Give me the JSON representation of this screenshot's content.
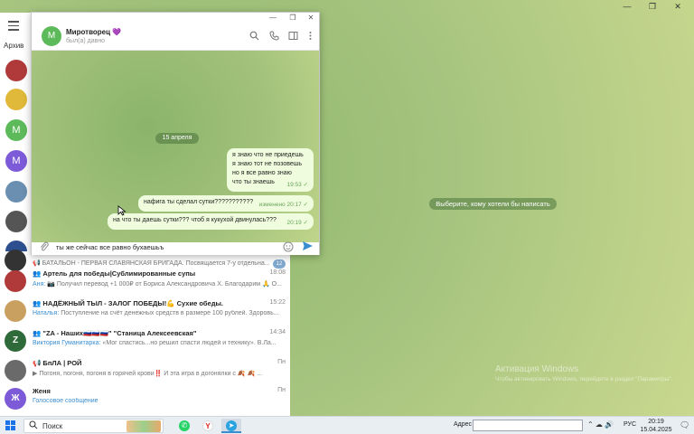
{
  "window": {
    "minimize": "—",
    "maximize": "❐",
    "close": "✕"
  },
  "sidebar": {
    "archive_label": "Архив",
    "avatars": [
      {
        "letter": "",
        "color": "#b03a3a"
      },
      {
        "letter": "",
        "color": "#e0b93a"
      },
      {
        "letter": "М",
        "color": "#5dba5a"
      },
      {
        "letter": "М",
        "color": "#7d5bd8"
      },
      {
        "letter": "",
        "color": "#6a8fb0"
      },
      {
        "letter": "",
        "color": "#555555"
      },
      {
        "letter": "",
        "color": "#2d4f8f"
      }
    ]
  },
  "popup": {
    "contact_initial": "М",
    "contact_name": "Миротворец 💜",
    "contact_status": "был(а) давно",
    "date_label": "15 апреля",
    "messages": [
      {
        "text_lines": [
          "я знаю что не приедешь",
          "я знаю тот не  позовешь",
          "но я все равно знаю",
          "что ты знаешь"
        ],
        "time": "19:53 ✓"
      },
      {
        "text_lines": [
          "нафига ты сделал сутки???????????"
        ],
        "time": "изменено 20:17 ✓"
      },
      {
        "text_lines": [
          "на что ты даешь сутки??? чтоб я кукухой двинулась???"
        ],
        "time": "20:19 ✓"
      }
    ],
    "input_value": "ты же сейчас все равно бухаешьъ"
  },
  "chat_list": [
    {
      "initial": "",
      "color": "#333333",
      "name": "",
      "time": "",
      "sender": "",
      "preview": "📢 БАТАЛЬОН - ПЕРВАЯ СЛАВЯНСКАЯ БРИГАДА. Посвящается 7-у отдельна...",
      "badge": "12"
    },
    {
      "initial": "",
      "color": "#b03a3a",
      "name": "👥 Артель для победы|Сублимированные супы",
      "time": "18:08",
      "sender": "Аня:",
      "preview": " 📷 Получил перевод +1 000₽ от Бориса Александровича Х. Благодарим 🙏 О..."
    },
    {
      "initial": "",
      "color": "#c9a060",
      "name": "👥 НАДЁЖНЫЙ ТЫЛ - ЗАЛОГ ПОБЕДЫ!💪 Сухие обеды.",
      "time": "15:22",
      "sender": "Наталья:",
      "preview": " Поступление на счёт денежных средств в размере 100 рублей. Здоровь..."
    },
    {
      "initial": "Z",
      "color": "#2f6b3a",
      "name": "👥 \"ZA - Наших🇷🇺🇷🇺🇷🇺\" \"Станица Алексеевская\"",
      "time": "14:34",
      "sender": "Виктория Гуманитарка:",
      "preview": " «Мог спастись...но решил спасти людей и технику». В.Ла..."
    },
    {
      "initial": "",
      "color": "#6a6a6a",
      "name": "📢 БпЛА | РОЙ",
      "time": "Пн",
      "sender": "",
      "preview": "▶ Погоня, погоня, погоня в горячей крови‼️ И эта игра в догонялки с 🍂 🍂 ..."
    },
    {
      "initial": "Ж",
      "color": "#7d5bd8",
      "name": "Женя",
      "time": "Пн",
      "sender": "",
      "preview": "Голосовое сообщение"
    }
  ],
  "right_panel": {
    "select_prompt": "Выберите, кому хотели бы написать",
    "activate_title": "Активация Windows",
    "activate_text": "Чтобы активировать Windows, перейдите в раздел \"Параметры\"."
  },
  "taskbar": {
    "search_label": "Поиск",
    "address_label": "Адрес",
    "language": "РУС",
    "time": "20:19",
    "date": "15.04.2025"
  },
  "colors": {
    "accent": "#3a8ed0",
    "bubble": "#effdde",
    "check": "#6aa35a"
  }
}
